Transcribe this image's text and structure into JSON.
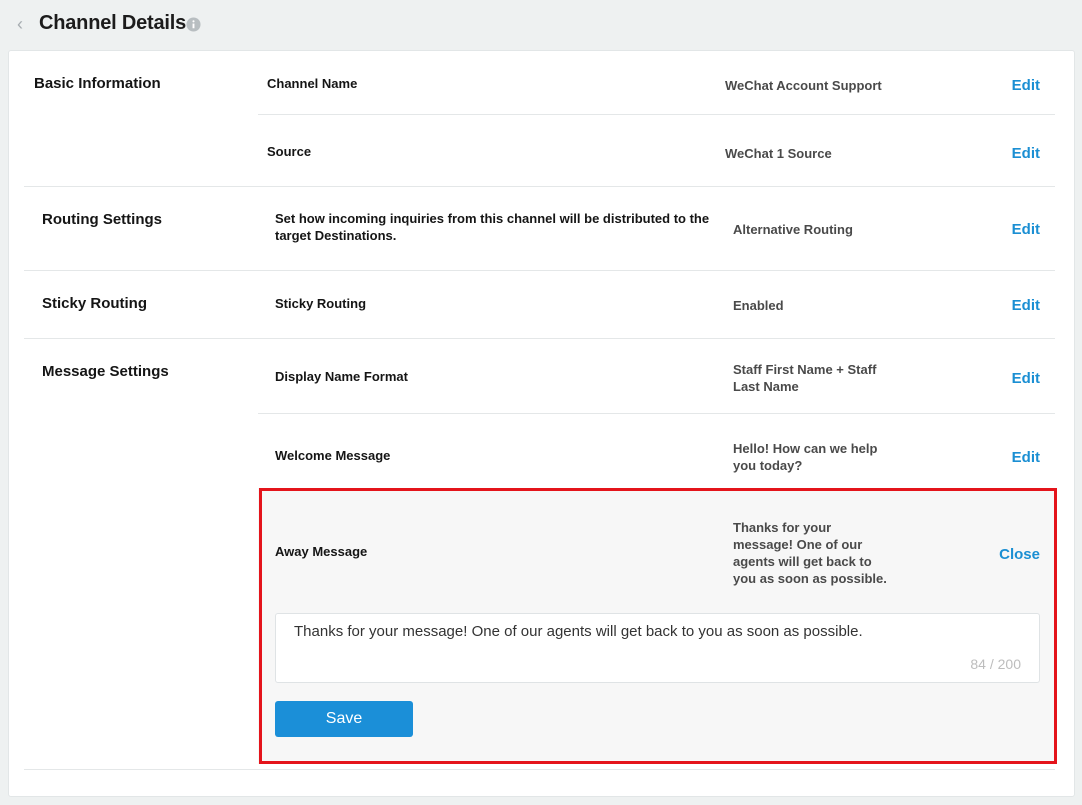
{
  "header": {
    "title": "Channel Details"
  },
  "sections": {
    "basic": {
      "label": "Basic Information",
      "rows": [
        {
          "field": "Channel Name",
          "value": "WeChat Account Support",
          "action": "Edit"
        },
        {
          "field": "Source",
          "value": "WeChat 1 Source",
          "action": "Edit"
        }
      ]
    },
    "routing": {
      "label": "Routing Settings",
      "rows": [
        {
          "field": "Set how incoming inquiries from this channel will be distributed to the target Destinations.",
          "value": "Alternative Routing",
          "action": "Edit"
        }
      ]
    },
    "sticky": {
      "label": "Sticky Routing",
      "rows": [
        {
          "field": "Sticky Routing",
          "value": "Enabled",
          "action": "Edit"
        }
      ]
    },
    "message": {
      "label": "Message Settings",
      "rows": [
        {
          "field": "Display Name Format",
          "value": "Staff First Name + Staff Last Name",
          "action": "Edit"
        },
        {
          "field": "Welcome Message",
          "value": "Hello! How can we help you today?",
          "action": "Edit"
        },
        {
          "field": "Away Message",
          "value": "Thanks for your message! One of our agents will get back to you as soon as possible.",
          "action": "Close"
        }
      ]
    }
  },
  "away_editor": {
    "text": "Thanks for your message! One of our agents will get back to you as soon as possible.",
    "char_count": "84 / 200",
    "save_label": "Save"
  },
  "colors": {
    "accent": "#1b8fd3",
    "highlight": "#e4141b"
  }
}
